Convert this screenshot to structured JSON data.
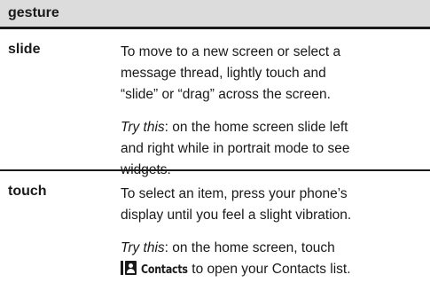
{
  "table": {
    "header": "gesture",
    "rows": [
      {
        "name": "slide",
        "desc_lines": [
          "To move to a new screen or select a",
          "message thread, lightly touch and",
          "“slide” or “drag” across the screen."
        ],
        "tip_label": "Try this",
        "tip_lines": [
          ": on the home screen slide left",
          "and right while in portrait mode to see",
          "widgets."
        ]
      },
      {
        "name": "touch",
        "desc_lines": [
          "To select an item, press your phone’s",
          "display until you feel a slight vibration."
        ],
        "tip_label": "Try this",
        "tip_lines": [
          ": on the home screen, touch"
        ],
        "tip_app": {
          "icon": "contacts-icon",
          "name": "Contacts",
          "rest": " to open your Contacts list."
        }
      }
    ]
  },
  "colors": {
    "header_bg": "#dcdcdc",
    "rule": "#1a1a1a",
    "text": "#1a1a1a"
  }
}
